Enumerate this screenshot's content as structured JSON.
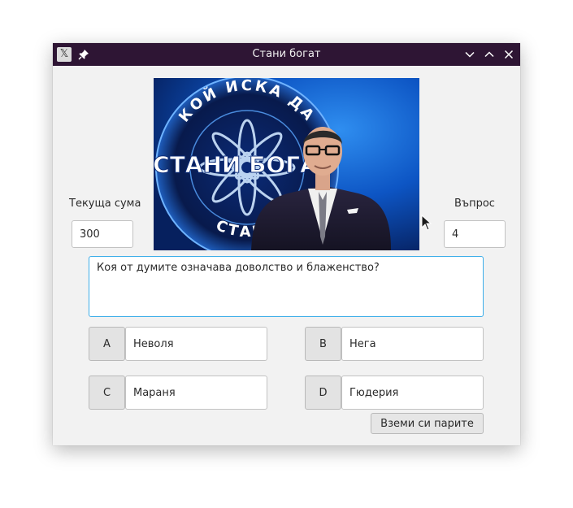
{
  "window": {
    "title": "Стани богат",
    "icons": {
      "app": "x-app-icon",
      "pin": "pin-icon",
      "minimize": "chevron-down-icon",
      "maximize": "chevron-up-icon",
      "close": "close-icon"
    },
    "colors": {
      "titlebar": "#2e1534",
      "focus": "#3daee9"
    }
  },
  "banner": {
    "arc_text": "КОЙ ИСКА ДА",
    "logo_text": "СТАНИ БОГАТ",
    "bottom_text": "СТАНЕ"
  },
  "current_sum": {
    "label": "Текуща сума",
    "value": "300"
  },
  "question_number": {
    "label": "Въпрос",
    "value": "4"
  },
  "question": {
    "text": "Коя от думите означава доволство и блаженство?"
  },
  "answers": [
    {
      "letter": "A",
      "text": "Неволя"
    },
    {
      "letter": "B",
      "text": "Нега"
    },
    {
      "letter": "C",
      "text": "Мараня"
    },
    {
      "letter": "D",
      "text": "Гюдерия"
    }
  ],
  "take_money_button": {
    "label": "Вземи си парите"
  }
}
